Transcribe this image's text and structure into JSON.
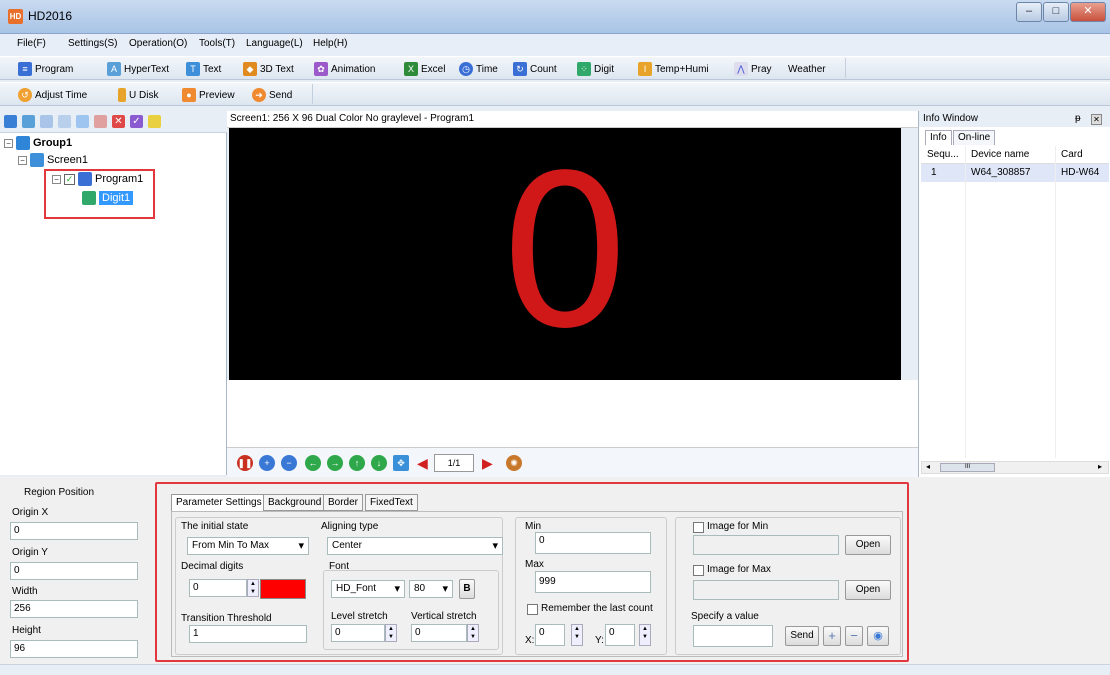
{
  "window": {
    "title": "HD2016",
    "app_icon": "hd-logo-icon",
    "min": "–",
    "max": "□",
    "close": "✕"
  },
  "menu": [
    "File(F)",
    "Settings(S)",
    "Operation(O)",
    "Tools(T)",
    "Language(L)",
    "Help(H)"
  ],
  "toolbar1": [
    {
      "label": "Program",
      "icon": "program-icon"
    },
    {
      "label": "HyperText",
      "icon": "hypertext-icon"
    },
    {
      "label": "Text",
      "icon": "text-icon"
    },
    {
      "label": "3D Text",
      "icon": "3d-text-icon"
    },
    {
      "label": "Animation",
      "icon": "animation-icon"
    },
    {
      "label": "Excel",
      "icon": "excel-icon"
    },
    {
      "label": "Time",
      "icon": "time-icon"
    },
    {
      "label": "Count",
      "icon": "count-icon"
    },
    {
      "label": "Digit",
      "icon": "digit-icon"
    },
    {
      "label": "Temp+Humi",
      "icon": "temp-humi-icon"
    },
    {
      "label": "Pray",
      "icon": "pray-icon"
    },
    {
      "label": "Weather",
      "icon": "weather-icon"
    }
  ],
  "toolbar2": [
    {
      "label": "Adjust Time",
      "icon": "adjust-time-icon"
    },
    {
      "label": "U Disk",
      "icon": "u-disk-icon"
    },
    {
      "label": "Preview",
      "icon": "preview-icon"
    },
    {
      "label": "Send",
      "icon": "send-icon"
    }
  ],
  "tree": {
    "group": "Group1",
    "screen": "Screen1",
    "program": "Program1",
    "digit": "Digit1"
  },
  "canvas": {
    "header": "Screen1: 256 X 96  Dual Color No graylevel - Program1",
    "display_value": "0",
    "display_color": "#d01818"
  },
  "playbar": {
    "page": "1/1"
  },
  "info": {
    "title": "Info Window",
    "pin": "ᵽ",
    "tabs": [
      "Info",
      "On-line"
    ],
    "columns": [
      "Sequ...",
      "Device name",
      "Card"
    ],
    "rows": [
      [
        "1",
        "W64_308857",
        "HD-W64"
      ]
    ],
    "scroll_label": "III"
  },
  "region": {
    "title": "Region Position",
    "origin_x_label": "Origin X",
    "origin_x": "0",
    "origin_y_label": "Origin Y",
    "origin_y": "0",
    "width_label": "Width",
    "width": "256",
    "height_label": "Height",
    "height": "96"
  },
  "params": {
    "tabs": [
      "Parameter Settings",
      "Background",
      "Border",
      "FixedText"
    ],
    "initial_state_label": "The initial state",
    "initial_state": "From Min To Max",
    "decimal_digits_label": "Decimal digits",
    "decimal_digits": "0",
    "color": "#ff0000",
    "transition_label": "Transition Threshold",
    "transition": "1",
    "aligning_label": "Aligning type",
    "aligning": "Center",
    "font_label": "Font",
    "font": "HD_Font",
    "font_size": "80",
    "bold": "B",
    "level_stretch_label": "Level stretch",
    "level_stretch": "0",
    "vertical_stretch_label": "Vertical stretch",
    "vertical_stretch": "0",
    "min_label": "Min",
    "min": "0",
    "max_label": "Max",
    "max": "999",
    "remember_label": "Remember the last count",
    "x_label": "X:",
    "x": "0",
    "y_label": "Y:",
    "y": "0",
    "image_min_label": "Image for Min",
    "image_max_label": "Image for Max",
    "open": "Open",
    "specify_label": "Specify a value",
    "send": "Send"
  }
}
